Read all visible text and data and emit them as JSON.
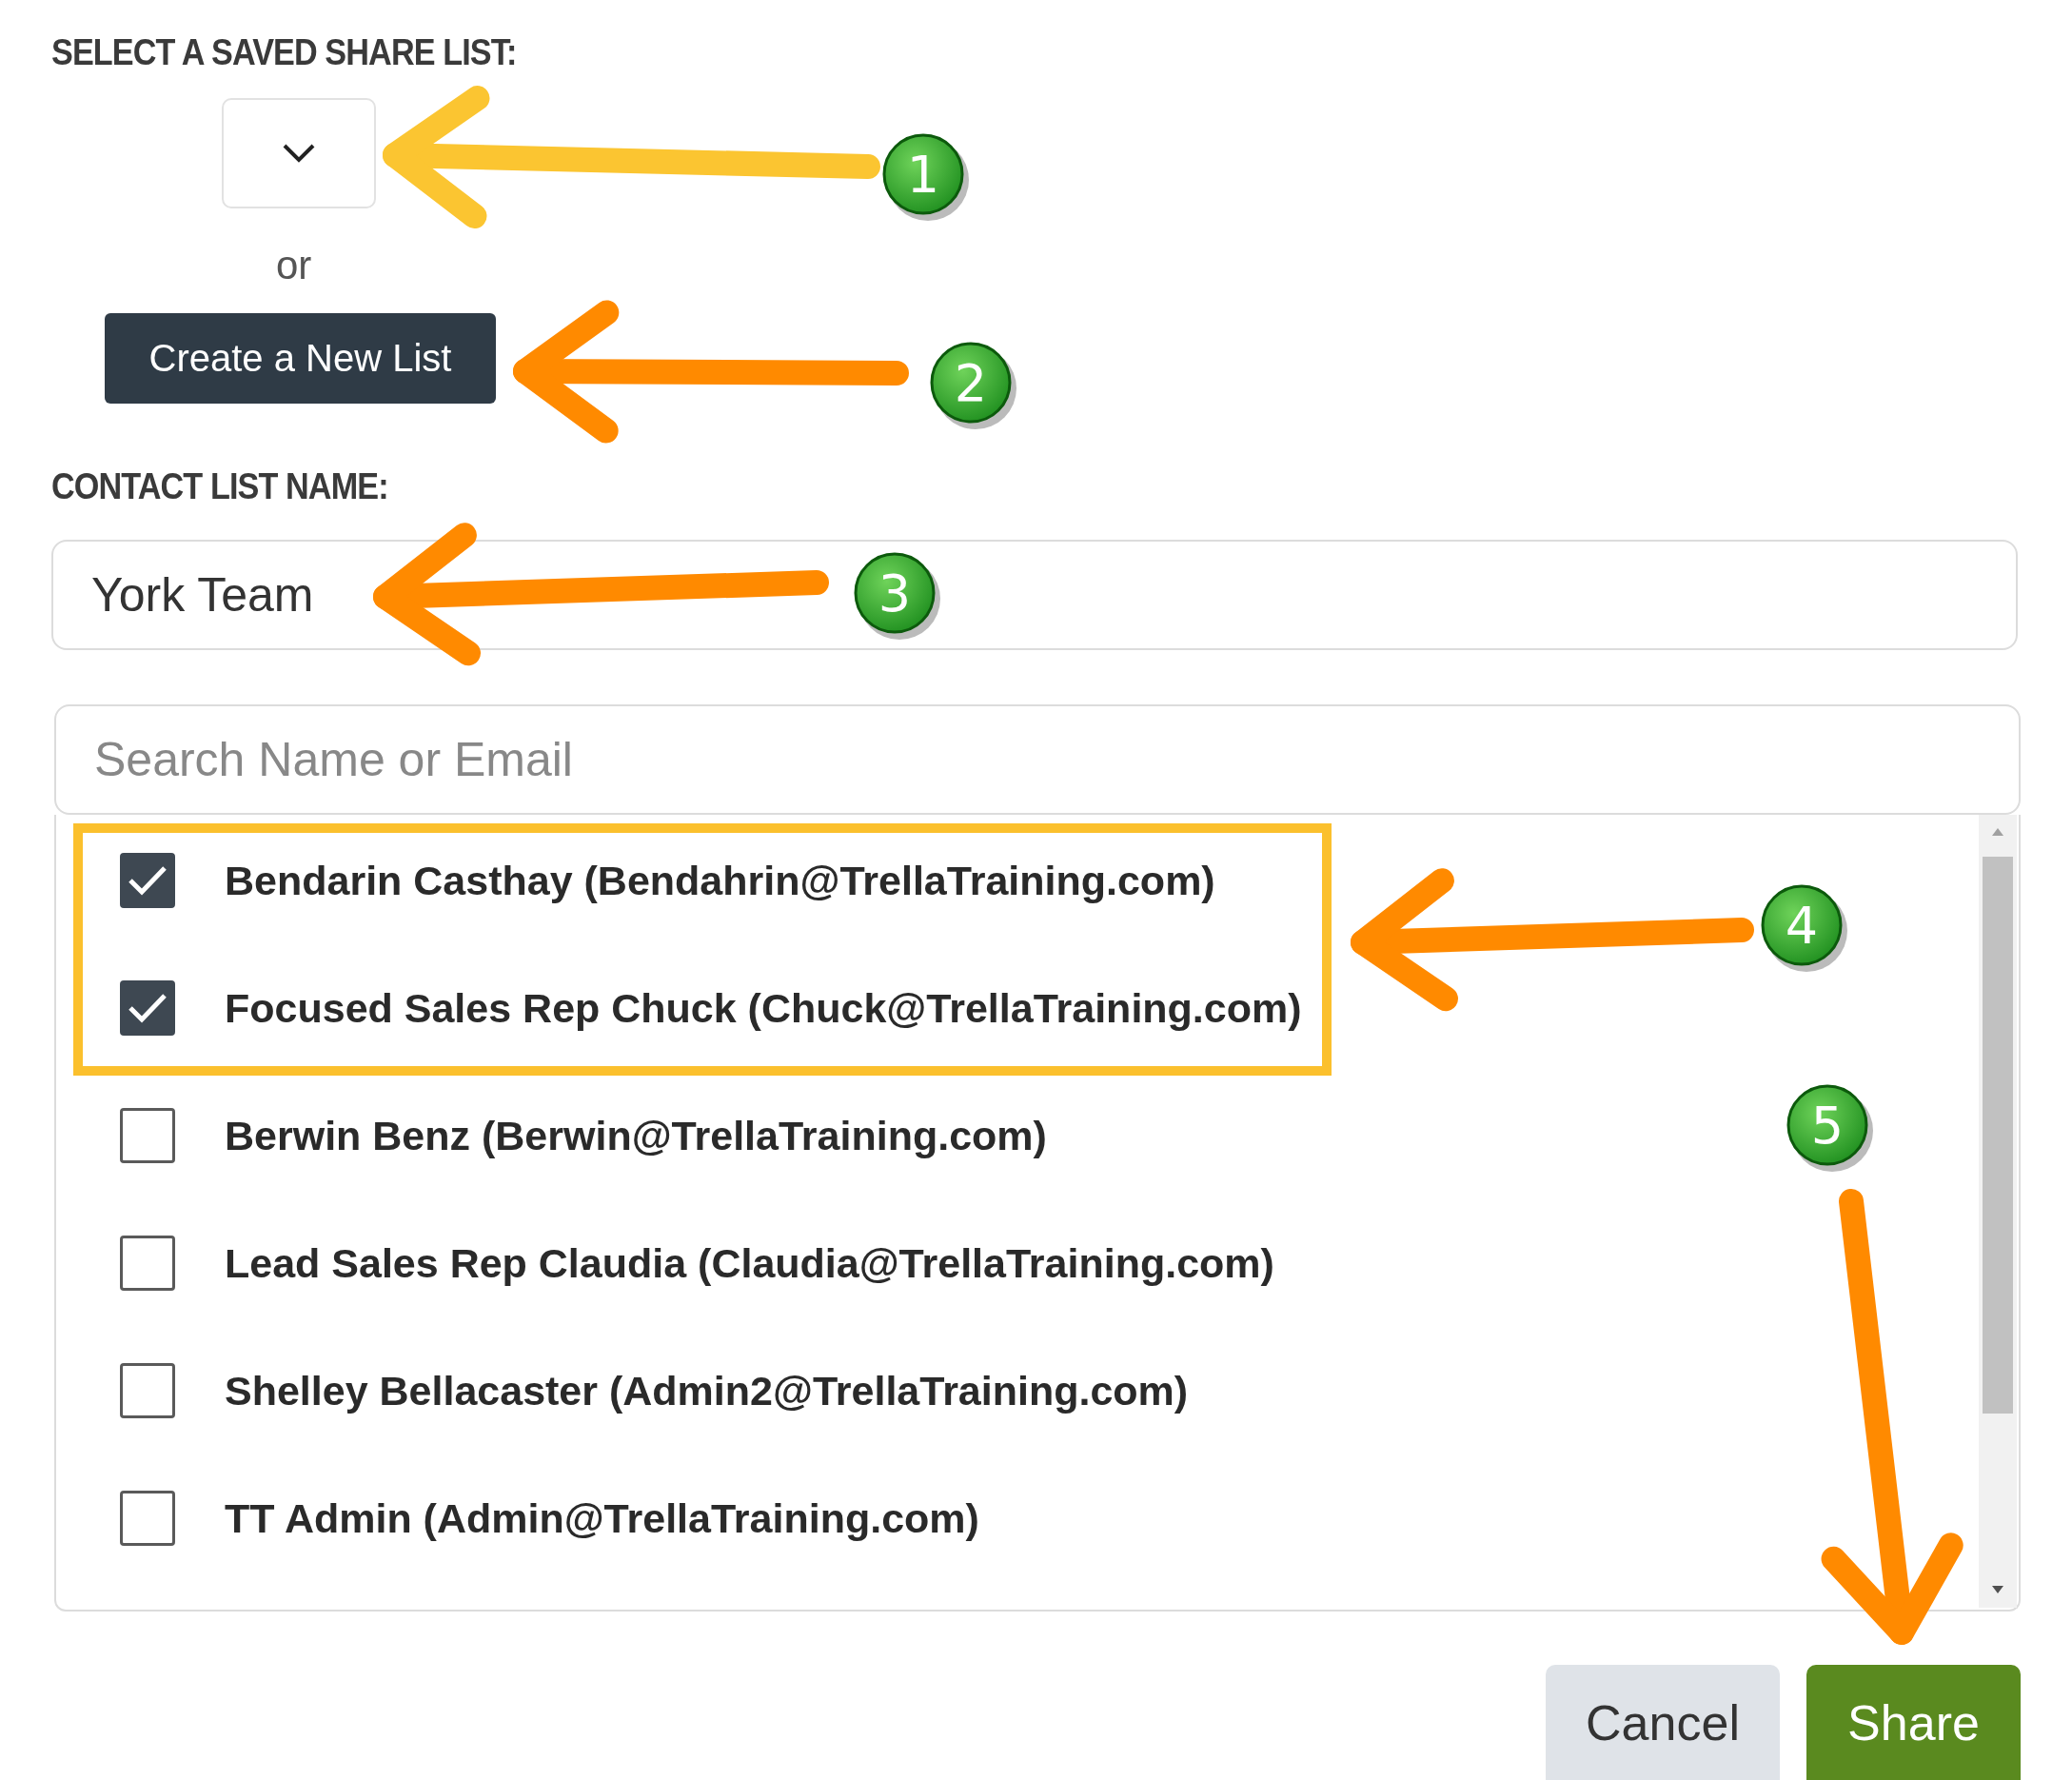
{
  "saved_list": {
    "label": "SELECT A SAVED SHARE LIST:",
    "separator": "or",
    "create_button": "Create a New List"
  },
  "contact_list_name": {
    "label": "CONTACT LIST NAME:",
    "value": "York Team"
  },
  "search": {
    "placeholder": "Search Name or Email"
  },
  "contacts": [
    {
      "label": "Bendarin Casthay (Bendahrin@TrellaTraining.com)",
      "checked": true
    },
    {
      "label": "Focused Sales Rep Chuck (Chuck@TrellaTraining.com)",
      "checked": true
    },
    {
      "label": "Berwin Benz (Berwin@TrellaTraining.com)",
      "checked": false
    },
    {
      "label": "Lead Sales Rep Claudia (Claudia@TrellaTraining.com)",
      "checked": false
    },
    {
      "label": "Shelley Bellacaster (Admin2@TrellaTraining.com)",
      "checked": false
    },
    {
      "label": "TT Admin (Admin@TrellaTraining.com)",
      "checked": false
    }
  ],
  "buttons": [
    {
      "label": "Cancel",
      "kind": "secondary"
    },
    {
      "label": "Share",
      "kind": "primary"
    }
  ],
  "highlight": {
    "color": "#fbc02d"
  },
  "annotations": [
    {
      "number": "1",
      "color": "#fbc531"
    },
    {
      "number": "2",
      "color": "#ff8a00"
    },
    {
      "number": "3",
      "color": "#ff8a00"
    },
    {
      "number": "4",
      "color": "#ff8a00"
    },
    {
      "number": "5",
      "color": "#ff8a00"
    }
  ]
}
